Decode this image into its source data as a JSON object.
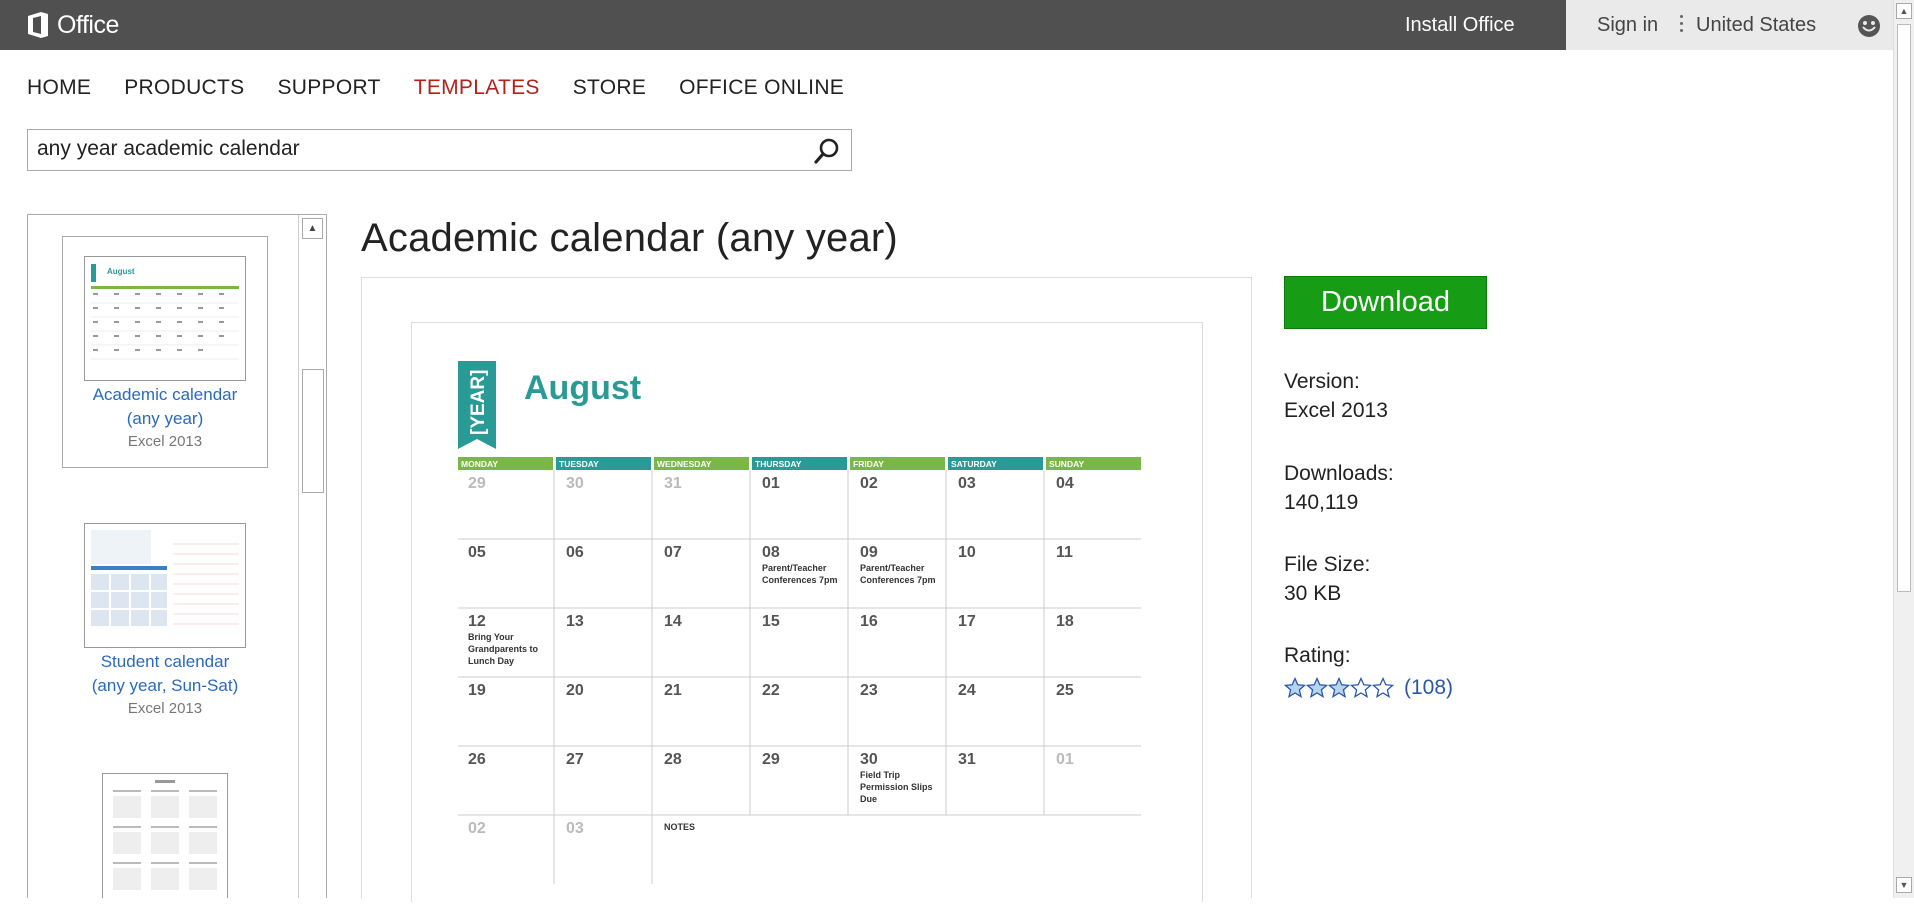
{
  "header": {
    "logo_text": "Office",
    "install_label": "Install Office",
    "signin_label": "Sign in",
    "country_label": "United States",
    "feedback_icon": "smiley-icon"
  },
  "nav": {
    "items": [
      "HOME",
      "PRODUCTS",
      "SUPPORT",
      "TEMPLATES",
      "STORE",
      "OFFICE ONLINE"
    ],
    "active": "TEMPLATES",
    "active_color": "#b1221b"
  },
  "search": {
    "value": "any year academic calendar",
    "icon": "search-icon"
  },
  "results": [
    {
      "title_line1": "Academic calendar",
      "title_line2": "(any year)",
      "app": "Excel 2013",
      "selected": true
    },
    {
      "title_line1": "Student calendar",
      "title_line2": "(any year, Sun-Sat)",
      "app": "Excel 2013",
      "selected": false
    },
    {
      "title_line1": "",
      "title_line2": "",
      "app": "",
      "selected": false
    }
  ],
  "template": {
    "title": "Academic calendar (any year)",
    "download_label": "Download",
    "version_label": "Version:",
    "version_value": "Excel 2013",
    "downloads_label": "Downloads:",
    "downloads_value": "140,119",
    "filesize_label": "File Size:",
    "filesize_value": "30 KB",
    "rating_label": "Rating:",
    "rating_stars": 3,
    "rating_max": 5,
    "rating_count": "(108)"
  },
  "calendar": {
    "year_tag": "[YEAR]",
    "month": "August",
    "days": [
      "MONDAY",
      "TUESDAY",
      "WEDNESDAY",
      "THURSDAY",
      "FRIDAY",
      "SATURDAY",
      "SUNDAY"
    ],
    "weeks": [
      [
        {
          "d": "29",
          "o": true
        },
        {
          "d": "30",
          "o": true
        },
        {
          "d": "31",
          "o": true
        },
        {
          "d": "01"
        },
        {
          "d": "02"
        },
        {
          "d": "03"
        },
        {
          "d": "04"
        }
      ],
      [
        {
          "d": "05"
        },
        {
          "d": "06"
        },
        {
          "d": "07"
        },
        {
          "d": "08",
          "n": "Parent/Teacher Conferences 7pm"
        },
        {
          "d": "09",
          "n": "Parent/Teacher Conferences 7pm"
        },
        {
          "d": "10"
        },
        {
          "d": "11"
        }
      ],
      [
        {
          "d": "12",
          "n": "Bring Your Grandparents to Lunch Day"
        },
        {
          "d": "13"
        },
        {
          "d": "14"
        },
        {
          "d": "15"
        },
        {
          "d": "16"
        },
        {
          "d": "17"
        },
        {
          "d": "18"
        }
      ],
      [
        {
          "d": "19"
        },
        {
          "d": "20"
        },
        {
          "d": "21"
        },
        {
          "d": "22"
        },
        {
          "d": "23"
        },
        {
          "d": "24"
        },
        {
          "d": "25"
        }
      ],
      [
        {
          "d": "26"
        },
        {
          "d": "27"
        },
        {
          "d": "28"
        },
        {
          "d": "29"
        },
        {
          "d": "30",
          "n": "Field Trip Permission Slips Due"
        },
        {
          "d": "31"
        },
        {
          "d": "01",
          "o": true
        }
      ],
      [
        {
          "d": "02",
          "o": true
        },
        {
          "d": "03",
          "o": true
        }
      ]
    ],
    "notes_label": "NOTES",
    "green": "#7ab648",
    "teal": "#2a9a96"
  }
}
